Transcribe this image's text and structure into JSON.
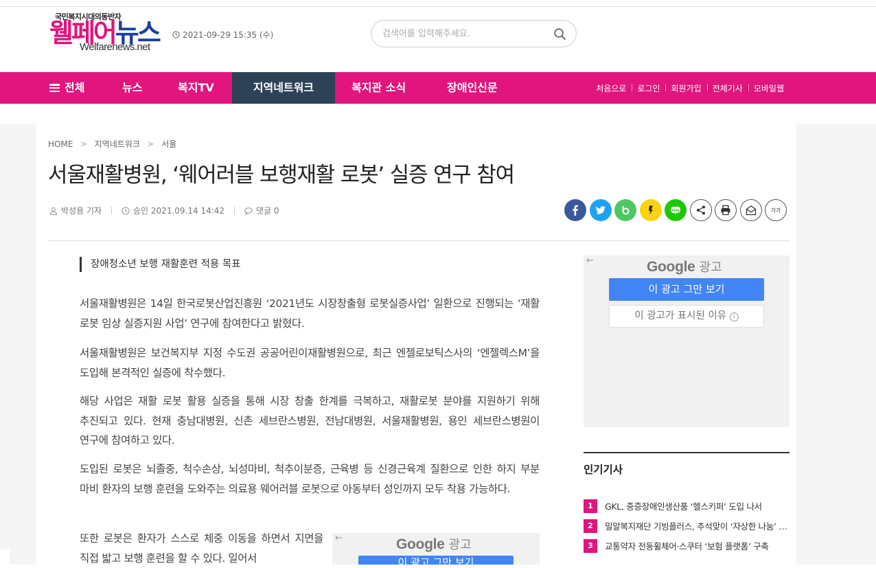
{
  "header": {
    "slogan": "국민복지시대의동반자",
    "logo_ko_1": "웰",
    "logo_ko_2": "페어",
    "logo_ko_3": "뉴스",
    "logo_en": "Welfarenews.net",
    "date": "2021-09-29 15:35 (수)",
    "search_placeholder": "검색어를 입력해주세요."
  },
  "nav": {
    "all": "전체",
    "items": [
      "뉴스",
      "복지TV",
      "지역네트워크",
      "복지관 소식",
      "장애인신문"
    ],
    "active_index": 2,
    "util": [
      "처음으로",
      "로그인",
      "회원가입",
      "전체기사",
      "모바일웹"
    ]
  },
  "article": {
    "breadcrumb": [
      "HOME",
      "지역네트워크",
      "서울"
    ],
    "title": "서울재활병원, ‘웨어러블 보행재활 로봇’ 실증 연구 참여",
    "reporter": "박성용 기자",
    "approved": "승인 2021.09.14 14:42",
    "comments": "댓글 0",
    "font_size_label": "가가",
    "subtitle": "장애청소년 보행 재활훈련 적용 목표",
    "paragraphs": [
      "서울재활병원은 14일 한국로봇산업진흥원 ‘2021년도 시장창출형 로봇실증사업’ 일환으로 진행되는 ‘재활 로봇 임상 실증지원 사업’ 연구에 참여한다고 밝혔다.",
      "서울재활병원은 보건복지부 지정 수도권 공공어린이재활병원으로, 최근 엔젤로보틱스사의 ‘엔젤렉스M’을 도입해 본격적인 실증에 착수했다.",
      "해당 사업은 재활 로봇 활용 실증을 통해 시장 창출 한계를 극복하고, 재활로봇 분야를 지원하기 위해 추진되고 있다. 현재 충남대병원, 신촌 세브란스병원, 전남대병원, 서울재활병원, 용인 세브란스병원이 연구에 참여하고 있다.",
      "도입된 로봇은 뇌졸중, 척수손상, 뇌성마비, 척추이분증, 근육병 등 신경근육계 질환으로 인한 하지 부분 마비 환자의 보행 훈련을 도와주는 의료용 웨어러블 로봇으로 아동부터 성인까지 모두 착용 가능하다.",
      "또한 로봇은 환자가 스스로 체중 이동을 하면서 지면을 직접 밟고 보행 훈련을 할 수 있다. 일어서"
    ]
  },
  "share_icons": [
    "facebook-icon",
    "twitter-icon",
    "band-icon",
    "kakaostory-icon",
    "blog-icon",
    "share-icon",
    "print-icon",
    "email-icon"
  ],
  "ads": {
    "google": "Google",
    "ad_label": "광고",
    "stop_button": "이 광고 그만 보기",
    "why_button": "이 광고가 표시된 이유",
    "back_arrow": "←"
  },
  "popular": {
    "heading": "인기기사",
    "items": [
      {
        "num": "1",
        "title": "GKL, 중증장애인생산품 ‘헬스키퍼’ 도입 나서"
      },
      {
        "num": "2",
        "title": "밀알복지재단 기빙플러스, 추석맞이 ‘자상한 나눔’ 캠페인"
      },
      {
        "num": "3",
        "title": "교통약자 전동휠체어·스쿠터 ‘보험 플랫폼’ 구축"
      }
    ]
  },
  "colors": {
    "brand_pink": "#e0157d",
    "brand_navy": "#1a3f9e",
    "nav_active": "#2d4257",
    "google_blue": "#4285f4"
  }
}
